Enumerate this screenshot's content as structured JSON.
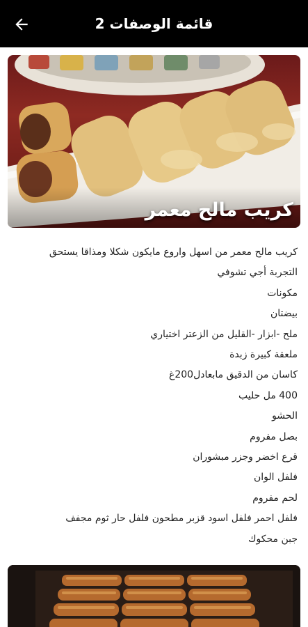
{
  "appbar": {
    "title": "قائمة الوصفات 2",
    "back_icon": "arrow-back-icon"
  },
  "hero": {
    "caption": "كريب مالح معمر"
  },
  "recipe_lines": [
    "كريب مالح معمر من اسهل واروع مايكون شكلا ومذاقا يستحق",
    "التجربة أجي تشوفي",
    "مكونات",
    "بيضتان",
    "ملح -ابزار -القليل من الزعتر اختياري",
    "ملعقة كبيرة زبدة",
    "كاسان من الدقيق مابعادل200غ",
    "400 مل حليب",
    "الحشو",
    "بصل مفروم",
    "قرع اخضر وجزر مبشوران",
    "فلفل الوان",
    "لحم مفروم",
    "فلفل احمر فلفل اسود قزبر مطحون فلفل حار ثوم مجفف",
    "جبن محكوك"
  ]
}
